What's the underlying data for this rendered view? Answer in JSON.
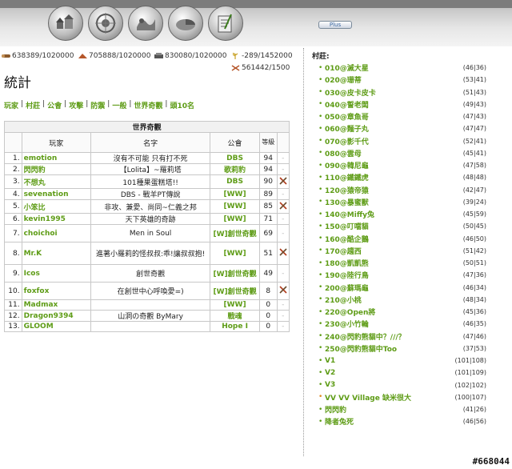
{
  "header": {
    "nav_icons": [
      "village-overview-icon",
      "village-center-icon",
      "map-icon",
      "statistics-icon",
      "reports-icon"
    ],
    "plus_label": "Plus"
  },
  "resources": {
    "wood": "638389/1020000",
    "clay": "705888/1020000",
    "iron": "830080/1020000",
    "crop": "-289/1452000",
    "crop_consumption": "561442/1500"
  },
  "page": {
    "title": "統計"
  },
  "menu": [
    "玩家",
    "村莊",
    "公會",
    "攻擊",
    "防禦",
    "一般",
    "世界奇觀",
    "頭10名"
  ],
  "table": {
    "caption": "世界奇觀",
    "headers": {
      "player": "玩家",
      "name": "名字",
      "alliance": "公會",
      "level": "等級"
    },
    "rows": [
      {
        "idx": "1.",
        "player": "emotion",
        "name": "沒有不可能 只有打不死",
        "alliance": "DBS",
        "level": "94",
        "attack": false
      },
      {
        "idx": "2.",
        "player": "閃閃豹",
        "name": "【Lolita】~羅莉塔",
        "alliance": "歌莉豹",
        "level": "94",
        "attack": false
      },
      {
        "idx": "3.",
        "player": "不想丸",
        "name": "101種果蛋糕塔!!",
        "alliance": "DBS",
        "level": "90",
        "attack": true
      },
      {
        "idx": "4.",
        "player": "sevenation",
        "name": "DBS - 戰羊PT傳說",
        "alliance": "[WW]",
        "level": "89",
        "attack": false
      },
      {
        "idx": "5.",
        "player": "小笨比",
        "name": "非攻、兼愛、尚同~仁義之邦",
        "alliance": "[WW]",
        "level": "85",
        "attack": true
      },
      {
        "idx": "6.",
        "player": "kevin1995",
        "name": "天下英雄的奇跡",
        "alliance": "[WW]",
        "level": "71",
        "attack": false
      },
      {
        "idx": "7.",
        "player": "choichoi",
        "name": "Men in Soul",
        "alliance": "[W]創世奇觀",
        "level": "69",
        "attack": false
      },
      {
        "idx": "8.",
        "player": "Mr.K",
        "name": "進著小羅莉的怪叔叔:乖!讓叔叔抱!",
        "alliance": "[WW]",
        "level": "51",
        "attack": true
      },
      {
        "idx": "9.",
        "player": "Icos",
        "name": "創世奇觀",
        "alliance": "[W]創世奇觀",
        "level": "49",
        "attack": false
      },
      {
        "idx": "10.",
        "player": "foxfox",
        "name": "在創世中心呼喚愛=)",
        "alliance": "[W]創世奇觀",
        "level": "8",
        "attack": true
      },
      {
        "idx": "11.",
        "player": "Madmax",
        "name": "",
        "alliance": "[WW]",
        "level": "0",
        "attack": false
      },
      {
        "idx": "12.",
        "player": "Dragon9394",
        "name": "山洞の奇觀 ByMary",
        "alliance": "戰魂",
        "level": "0",
        "attack": false
      },
      {
        "idx": "13.",
        "player": "GLOOM",
        "name": "",
        "alliance": "Hope I",
        "level": "0",
        "attack": false
      }
    ]
  },
  "villages": {
    "title": "村莊:",
    "items": [
      {
        "name": "010@滅大星",
        "coord": "(46|36)",
        "active": false
      },
      {
        "name": "020@珊蒂",
        "coord": "(53|41)",
        "active": false
      },
      {
        "name": "030@皮卡皮卡",
        "coord": "(51|43)",
        "active": false
      },
      {
        "name": "040@誓老闆",
        "coord": "(49|43)",
        "active": false
      },
      {
        "name": "050@章魚哥",
        "coord": "(47|43)",
        "active": false
      },
      {
        "name": "060@麵子丸",
        "coord": "(47|47)",
        "active": false
      },
      {
        "name": "070@影千代",
        "coord": "(52|41)",
        "active": false
      },
      {
        "name": "080@雲母",
        "coord": "(45|41)",
        "active": false
      },
      {
        "name": "090@韓尼龜",
        "coord": "(47|58)",
        "active": false
      },
      {
        "name": "110@鐵鐵虎",
        "coord": "(48|48)",
        "active": false
      },
      {
        "name": "120@猿帝猿",
        "coord": "(42|47)",
        "active": false
      },
      {
        "name": "130@暴蜜獸",
        "coord": "(39|24)",
        "active": false
      },
      {
        "name": "140@Miffy兔",
        "coord": "(45|59)",
        "active": false
      },
      {
        "name": "150@叮噹貓",
        "coord": "(50|45)",
        "active": false
      },
      {
        "name": "160@酷企鵝",
        "coord": "(46|50)",
        "active": false
      },
      {
        "name": "170@趨西",
        "coord": "(51|42)",
        "active": false
      },
      {
        "name": "180@凱凱熊",
        "coord": "(50|51)",
        "active": false
      },
      {
        "name": "190@陸行鳥",
        "coord": "(47|36)",
        "active": false
      },
      {
        "name": "200@蘇瑪龜",
        "coord": "(46|34)",
        "active": false
      },
      {
        "name": "210@小桃",
        "coord": "(48|34)",
        "active": false
      },
      {
        "name": "220@Open將",
        "coord": "(45|36)",
        "active": false
      },
      {
        "name": "230@小竹輪",
        "coord": "(46|35)",
        "active": false
      },
      {
        "name": "240@閃豹熊貓中？///？",
        "coord": "(47|46)",
        "active": false
      },
      {
        "name": "250@閃豹熊貓中Too",
        "coord": "(37|53)",
        "active": false
      },
      {
        "name": "V1",
        "coord": "(101|108)",
        "active": false
      },
      {
        "name": "V2",
        "coord": "(101|109)",
        "active": false
      },
      {
        "name": "V3",
        "coord": "(102|102)",
        "active": false
      },
      {
        "name": "VV VV Village 缺米很大",
        "coord": "(100|107)",
        "active": true
      },
      {
        "name": "閃閃豹",
        "coord": "(41|26)",
        "active": false
      },
      {
        "name": "降者兔死",
        "coord": "(46|56)",
        "active": false
      }
    ]
  },
  "watermark": "#668044"
}
